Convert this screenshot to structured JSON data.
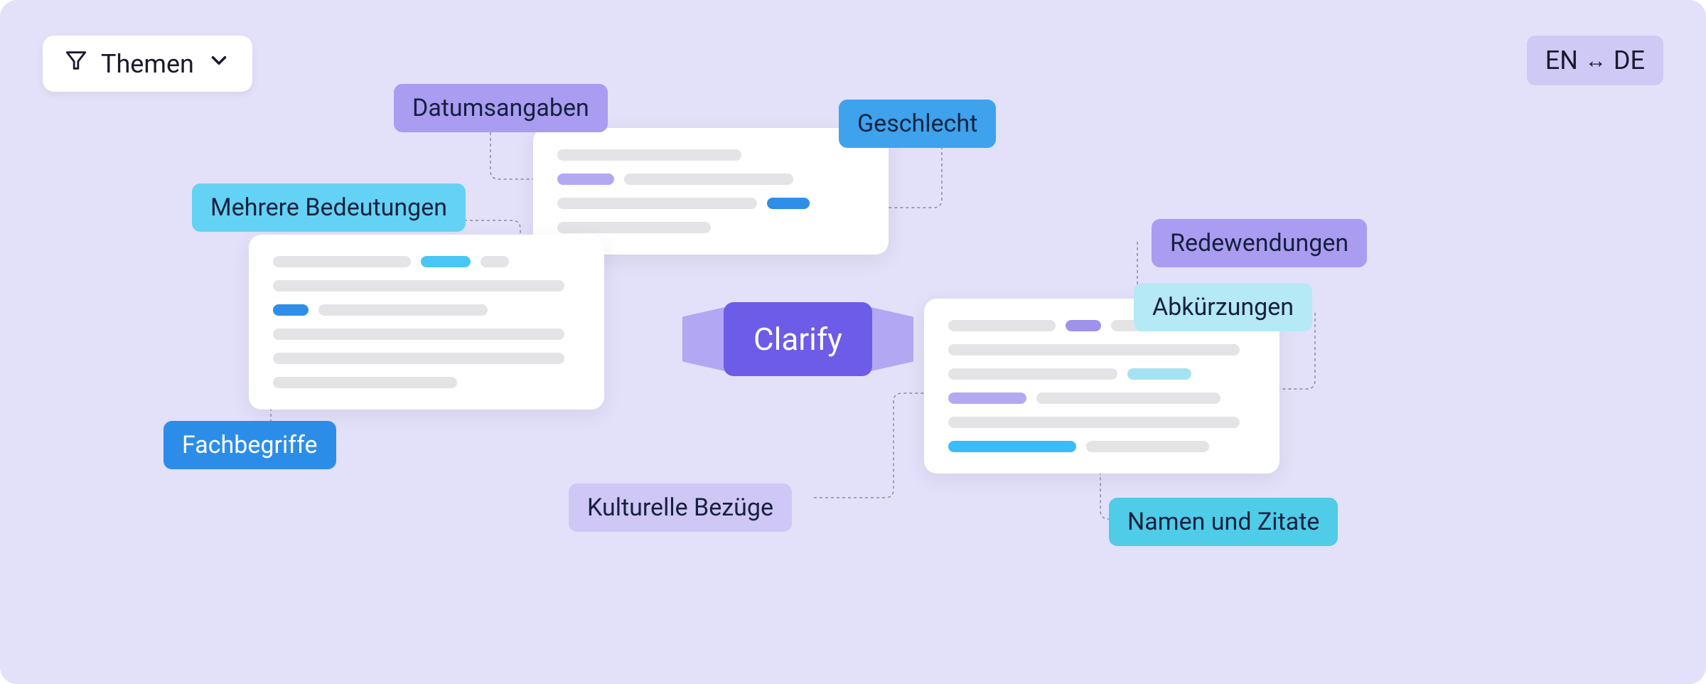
{
  "header": {
    "themen_label": "Themen"
  },
  "lang": {
    "from": "EN",
    "to": "DE"
  },
  "center": {
    "label": "Clarify"
  },
  "tags": {
    "mehrere_bedeutungen": "Mehrere Bedeutungen",
    "datumsangaben": "Datumsangaben",
    "geschlecht": "Geschlecht",
    "fachbegriffe": "Fachbegriffe",
    "kulturelle_bezuege": "Kulturelle Bezüge",
    "redewendungen": "Redewendungen",
    "abkuerzungen": "Abkürzungen",
    "namen_und_zitate": "Namen und Zitate"
  }
}
